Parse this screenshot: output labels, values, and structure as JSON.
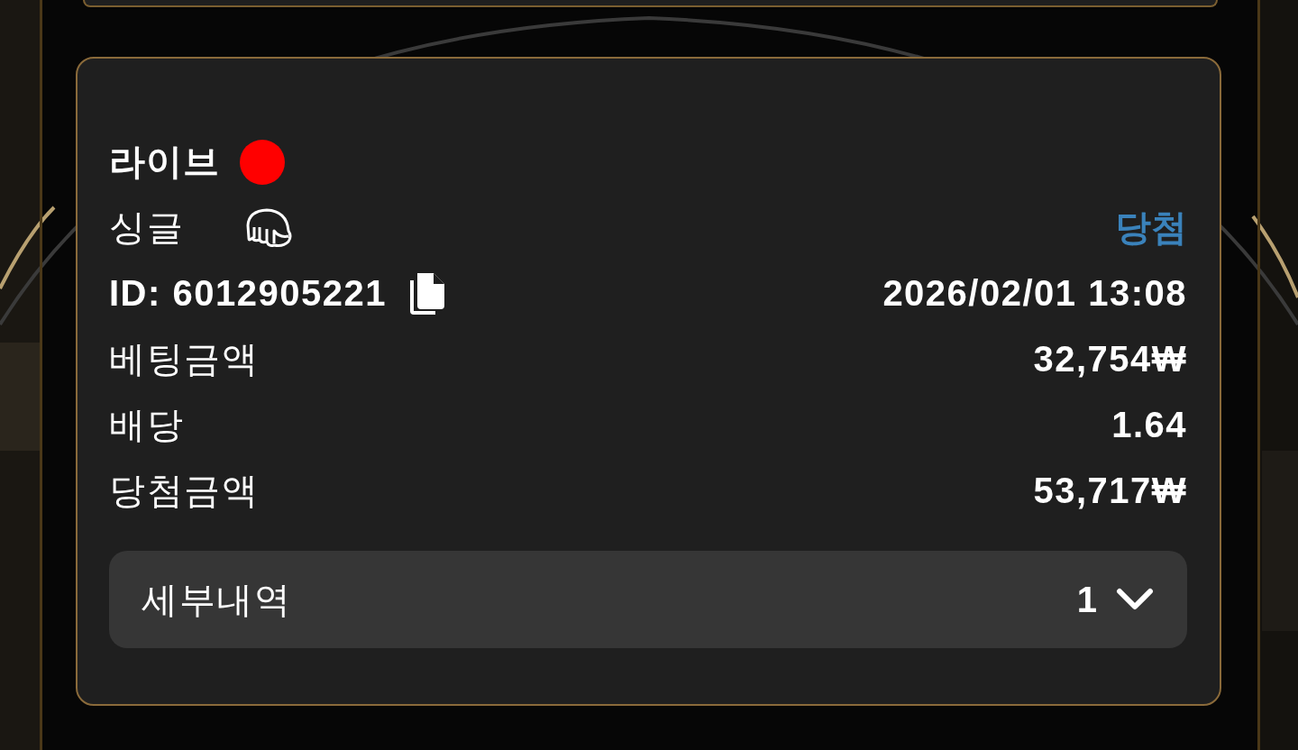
{
  "bet": {
    "category": "라이브",
    "live": true,
    "bet_type": "싱글",
    "status": {
      "label": "당첨",
      "kind": "win"
    },
    "id": "ID: 6012905221",
    "datetime": "2026/02/01 13:08",
    "rows": [
      {
        "label": "베팅금액",
        "value": "32,754₩"
      },
      {
        "label": "배당",
        "value": "1.64"
      },
      {
        "label": "당첨금액",
        "value": "53,717₩"
      }
    ],
    "details": {
      "label": "세부내역",
      "count": "1",
      "expanded": false
    }
  }
}
